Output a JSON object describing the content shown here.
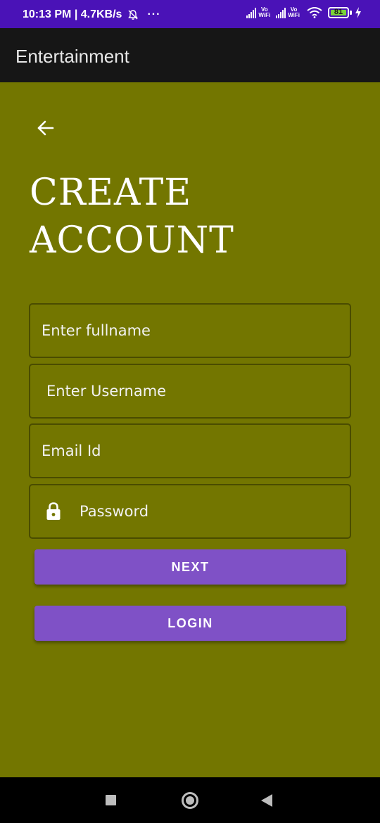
{
  "status_bar": {
    "time_speed": "10:13 PM | 4.7KB/s",
    "dots": "···",
    "vowifi_top": "Vo",
    "vowifi_bottom": "WiFi",
    "battery_level": "81"
  },
  "app_bar": {
    "title": "Entertainment"
  },
  "heading": {
    "line1": "CREATE",
    "line2": "ACCOUNT"
  },
  "form": {
    "fullname_placeholder": "Enter fullname",
    "username_placeholder": "Enter Username",
    "email_placeholder": "Email Id",
    "password_placeholder": "Password"
  },
  "buttons": {
    "next": "NEXT",
    "login": "LOGIN"
  },
  "colors": {
    "status_bar": "#4a12b7",
    "app_bar": "#161616",
    "background": "#737600",
    "button": "#7f51c6"
  },
  "icons": {
    "back": "arrow-left-icon",
    "lock": "lock-icon",
    "mute": "bell-off-icon",
    "wifi": "wifi-icon",
    "charging": "bolt-icon"
  }
}
